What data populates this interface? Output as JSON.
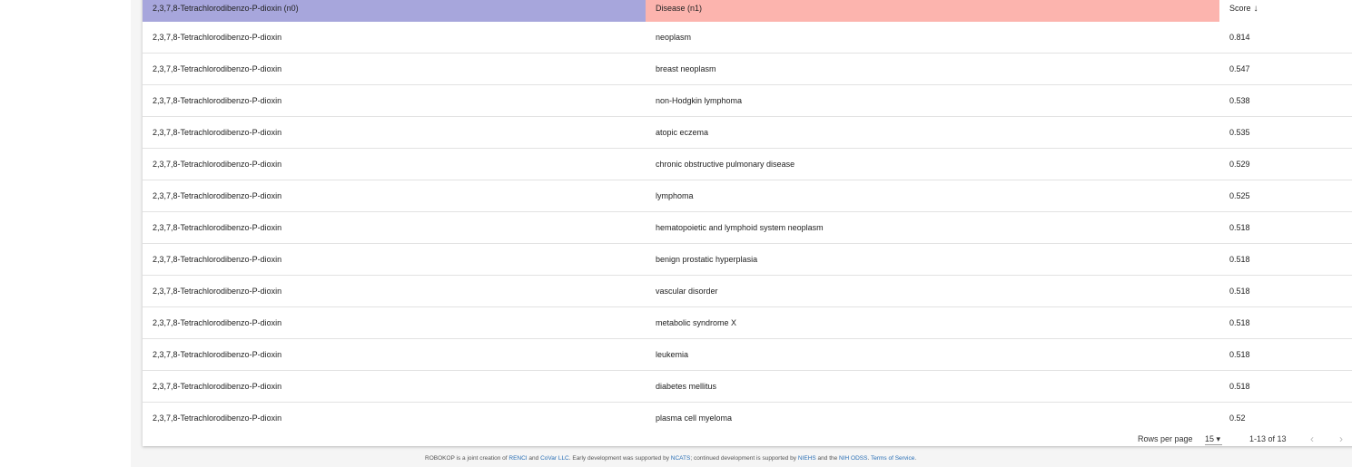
{
  "table": {
    "headers": {
      "chemical": "2,3,7,8-Tetrachlorodibenzo-P-dioxin (n0)",
      "disease": "Disease (n1)",
      "score": "Score",
      "sort_arrow": "↓"
    },
    "rows": [
      {
        "chemical": "2,3,7,8-Tetrachlorodibenzo-P-dioxin",
        "disease": "neoplasm",
        "score": "0.814"
      },
      {
        "chemical": "2,3,7,8-Tetrachlorodibenzo-P-dioxin",
        "disease": "breast neoplasm",
        "score": "0.547"
      },
      {
        "chemical": "2,3,7,8-Tetrachlorodibenzo-P-dioxin",
        "disease": "non-Hodgkin lymphoma",
        "score": "0.538"
      },
      {
        "chemical": "2,3,7,8-Tetrachlorodibenzo-P-dioxin",
        "disease": "atopic eczema",
        "score": "0.535"
      },
      {
        "chemical": "2,3,7,8-Tetrachlorodibenzo-P-dioxin",
        "disease": "chronic obstructive pulmonary disease",
        "score": "0.529"
      },
      {
        "chemical": "2,3,7,8-Tetrachlorodibenzo-P-dioxin",
        "disease": "lymphoma",
        "score": "0.525"
      },
      {
        "chemical": "2,3,7,8-Tetrachlorodibenzo-P-dioxin",
        "disease": "hematopoietic and lymphoid system neoplasm",
        "score": "0.518"
      },
      {
        "chemical": "2,3,7,8-Tetrachlorodibenzo-P-dioxin",
        "disease": "benign prostatic hyperplasia",
        "score": "0.518"
      },
      {
        "chemical": "2,3,7,8-Tetrachlorodibenzo-P-dioxin",
        "disease": "vascular disorder",
        "score": "0.518"
      },
      {
        "chemical": "2,3,7,8-Tetrachlorodibenzo-P-dioxin",
        "disease": "metabolic syndrome X",
        "score": "0.518"
      },
      {
        "chemical": "2,3,7,8-Tetrachlorodibenzo-P-dioxin",
        "disease": "leukemia",
        "score": "0.518"
      },
      {
        "chemical": "2,3,7,8-Tetrachlorodibenzo-P-dioxin",
        "disease": "diabetes mellitus",
        "score": "0.518"
      },
      {
        "chemical": "2,3,7,8-Tetrachlorodibenzo-P-dioxin",
        "disease": "plasma cell myeloma",
        "score": "0.52"
      }
    ]
  },
  "pagination": {
    "rows_per_page_label": "Rows per page",
    "rows_per_page_value": "15",
    "range_text": "1-13 of 13",
    "prev_icon": "chevron-left-icon",
    "next_icon": "chevron-right-icon"
  },
  "footer": {
    "t1": "ROBOKOP is a joint creation of ",
    "renci": "RENCI",
    "t2": " and ",
    "covar": "CoVar LLC",
    "t3": ". Early development was supported by ",
    "ncats": "NCATS",
    "t4": "; continued development is supported by ",
    "niehs": "NIEHS",
    "t5": " and the ",
    "nih": "NIH ODSS",
    "t6": ". ",
    "terms": "Terms of Service",
    "t7": "."
  },
  "colors": {
    "chemical_header": "#a7a6dc",
    "disease_header": "#fcb4ae",
    "link": "#2a6fb5"
  }
}
